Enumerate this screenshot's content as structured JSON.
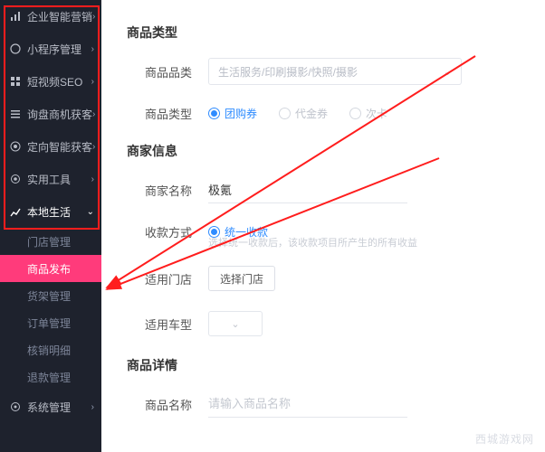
{
  "sidebar": {
    "items": [
      {
        "label": "企业智能营销",
        "icon": "bars"
      },
      {
        "label": "小程序管理",
        "icon": "circle"
      },
      {
        "label": "短视频SEO",
        "icon": "grid"
      },
      {
        "label": "询盘商机获客",
        "icon": "lines"
      },
      {
        "label": "定向智能获客",
        "icon": "target"
      },
      {
        "label": "实用工具",
        "icon": "gear"
      }
    ],
    "activeSection": {
      "label": "本地生活",
      "icon": "growth"
    },
    "subItems": [
      {
        "label": "门店管理"
      },
      {
        "label": "商品发布",
        "active": true
      },
      {
        "label": "货架管理"
      },
      {
        "label": "订单管理"
      },
      {
        "label": "核销明细"
      },
      {
        "label": "退款管理"
      }
    ],
    "tailItem": {
      "label": "系统管理",
      "icon": "cog"
    }
  },
  "main": {
    "section1": {
      "title": "商品类型",
      "category": {
        "label": "商品品类",
        "placeholder": "生活服务/印刷摄影/快照/摄影"
      },
      "type": {
        "label": "商品类型",
        "options": [
          "团购券",
          "代金券",
          "次卡"
        ],
        "selected": 0
      }
    },
    "section2": {
      "title": "商家信息",
      "merchantName": {
        "label": "商家名称",
        "value": "极氪"
      },
      "payment": {
        "label": "收款方式",
        "options": [
          "统一收款"
        ],
        "selected": 0,
        "hint": "选择统一收款后，该收款项目所产生的所有收益"
      },
      "stores": {
        "label": "适用门店",
        "button": "选择门店"
      },
      "cars": {
        "label": "适用车型"
      }
    },
    "section3": {
      "title": "商品详情",
      "productName": {
        "label": "商品名称",
        "placeholder": "请输入商品名称"
      }
    }
  },
  "watermark": "西城游戏网"
}
